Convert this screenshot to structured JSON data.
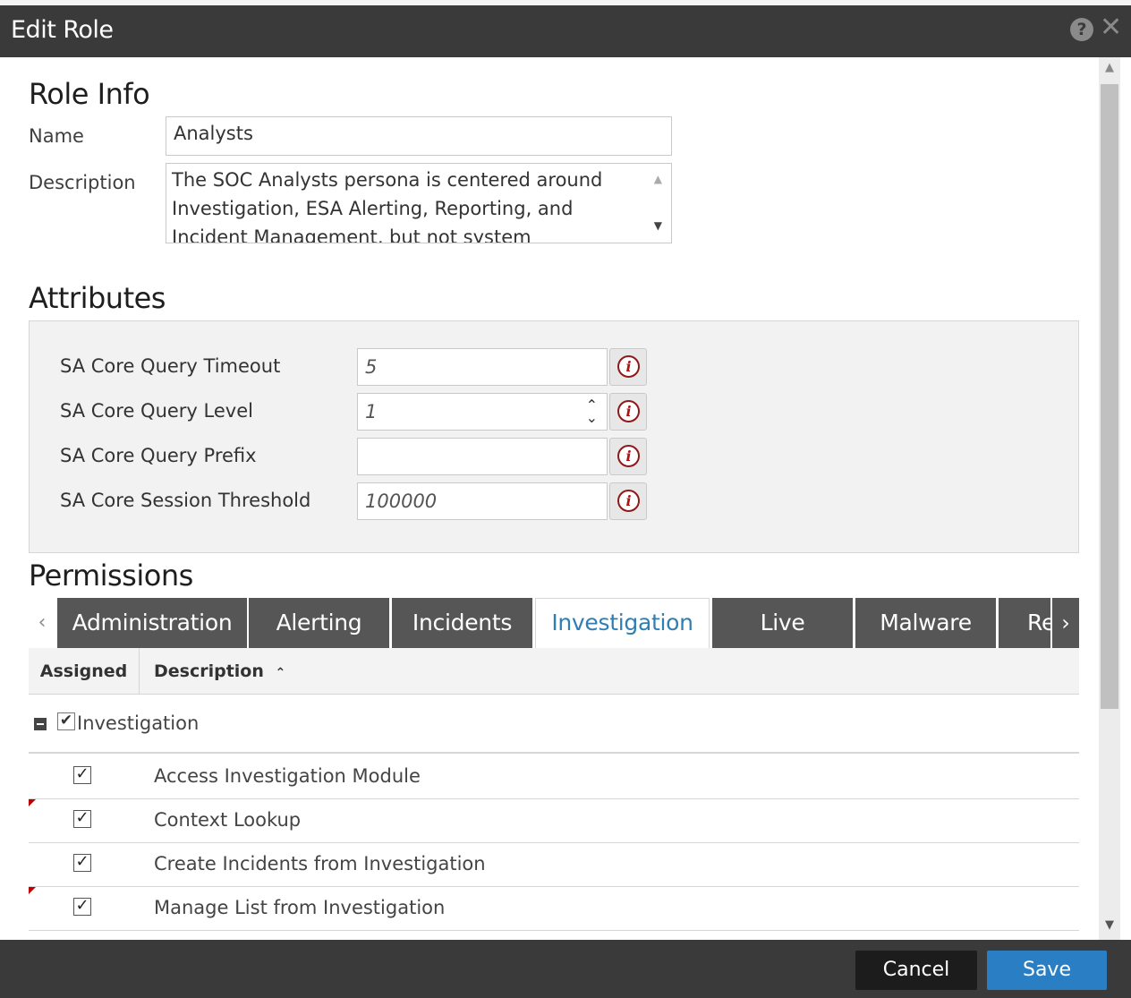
{
  "dialog": {
    "title": "Edit Role"
  },
  "role_info": {
    "heading": "Role Info",
    "name_label": "Name",
    "name_value": "Analysts",
    "description_label": "Description",
    "description_value": "The SOC Analysts persona is centered around Investigation, ESA Alerting, Reporting, and Incident Management, but not system"
  },
  "attributes": {
    "heading": "Attributes",
    "items": [
      {
        "label": "SA Core Query Timeout",
        "value": "5"
      },
      {
        "label": "SA Core Query Level",
        "value": "1"
      },
      {
        "label": "SA Core Query Prefix",
        "value": ""
      },
      {
        "label": "SA Core Session Threshold",
        "value": "100000"
      }
    ]
  },
  "permissions": {
    "heading": "Permissions",
    "tabs": [
      {
        "label": "Administration",
        "active": false
      },
      {
        "label": "Alerting",
        "active": false
      },
      {
        "label": "Incidents",
        "active": false
      },
      {
        "label": "Investigation",
        "active": true
      },
      {
        "label": "Live",
        "active": false
      },
      {
        "label": "Malware",
        "active": false
      },
      {
        "label": "Re",
        "active": false
      }
    ],
    "columns": {
      "assigned": "Assigned",
      "description": "Description"
    },
    "group": {
      "label": "Investigation",
      "checked": true
    },
    "rows": [
      {
        "label": "Access Investigation Module",
        "checked": true,
        "modified": false
      },
      {
        "label": "Context Lookup",
        "checked": true,
        "modified": true
      },
      {
        "label": "Create Incidents from Investigation",
        "checked": true,
        "modified": false
      },
      {
        "label": "Manage List from Investigation",
        "checked": true,
        "modified": true
      }
    ]
  },
  "footer": {
    "cancel_label": "Cancel",
    "save_label": "Save"
  },
  "icons": {
    "help": "help-icon",
    "close": "close-icon",
    "info": "info-icon",
    "check": "checkmark-icon"
  },
  "colors": {
    "titlebar": "#3a3a3a",
    "tab_inactive": "#565656",
    "tab_active_text": "#2f7fb3",
    "save_button": "#2a7fc4",
    "cancel_button": "#1c1c1c",
    "info_icon": "#b31212",
    "modified_marker": "#c00000"
  }
}
